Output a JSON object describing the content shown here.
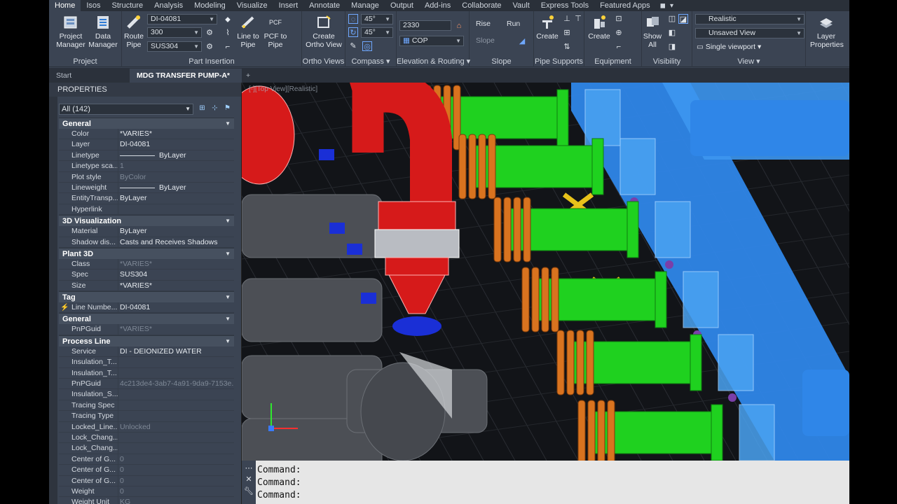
{
  "ribbon_tabs": [
    "Home",
    "Isos",
    "Structure",
    "Analysis",
    "Modeling",
    "Visualize",
    "Insert",
    "Annotate",
    "Manage",
    "Output",
    "Add-ins",
    "Collaborate",
    "Vault",
    "Express Tools",
    "Featured Apps"
  ],
  "project": {
    "project_manager": "Project Manager",
    "data_manager": "Data Manager",
    "title": "Project"
  },
  "part_insertion": {
    "route_pipe": "Route Pipe",
    "line_value": "DI-04081",
    "size_value": "300",
    "spec_value": "SUS304",
    "line_to_pipe": "Line to Pipe",
    "pcf_to_pipe": "PCF to Pipe",
    "pcf_label": "PCF",
    "title": "Part Insertion"
  },
  "ortho": {
    "create": "Create Ortho View",
    "title": "Ortho Views"
  },
  "compass": {
    "angle1": "45°",
    "angle2": "45°",
    "title": "Compass"
  },
  "elevation": {
    "value": "2330",
    "cop": "COP",
    "title": "Elevation & Routing"
  },
  "slope": {
    "rise": "Rise",
    "run": "Run",
    "slope": "Slope",
    "title": "Slope"
  },
  "pipe_supports": {
    "create": "Create",
    "title": "Pipe Supports"
  },
  "equipment": {
    "create": "Create",
    "title": "Equipment"
  },
  "visibility": {
    "show_all": "Show All",
    "title": "Visibility"
  },
  "view": {
    "visual_style": "Realistic",
    "named_view": "Unsaved View",
    "viewport": "Single viewport",
    "title": "View"
  },
  "layer": {
    "props": "Layer Properties"
  },
  "doc_tabs": {
    "start": "Start",
    "active": "MDG TRANSFER PUMP-A*",
    "plus": "+"
  },
  "properties": {
    "header": "PROPERTIES",
    "selection": "All (142)",
    "sections": [
      {
        "title": "General",
        "rows": [
          {
            "k": "Color",
            "v": "*VARIES*"
          },
          {
            "k": "Layer",
            "v": "DI-04081"
          },
          {
            "k": "Linetype",
            "v": "ByLayer",
            "line": true
          },
          {
            "k": "Linetype sca...",
            "v": "1",
            "dim": true
          },
          {
            "k": "Plot style",
            "v": "ByColor",
            "dim": true
          },
          {
            "k": "Lineweight",
            "v": "ByLayer",
            "line": true
          },
          {
            "k": "EntityTransp...",
            "v": "ByLayer"
          },
          {
            "k": "Hyperlink",
            "v": ""
          }
        ]
      },
      {
        "title": "3D Visualization",
        "rows": [
          {
            "k": "Material",
            "v": "ByLayer"
          },
          {
            "k": "Shadow dis...",
            "v": "Casts and Receives Shadows"
          }
        ]
      },
      {
        "title": "Plant 3D",
        "rows": [
          {
            "k": "Class",
            "v": "*VARIES*",
            "dim": true
          },
          {
            "k": "Spec",
            "v": "SUS304"
          },
          {
            "k": "Size",
            "v": "*VARIES*"
          }
        ]
      },
      {
        "title": "Tag",
        "rows": [
          {
            "k": "Line Numbe...",
            "v": "DI-04081",
            "bolt": true
          }
        ]
      },
      {
        "title": "General",
        "rows": [
          {
            "k": "PnPGuid",
            "v": "*VARIES*",
            "dim": true
          }
        ]
      },
      {
        "title": "Process Line",
        "rows": [
          {
            "k": "Service",
            "v": "DI - DEIONIZED WATER"
          },
          {
            "k": "Insulation_T...",
            "v": ""
          },
          {
            "k": "Insulation_T...",
            "v": ""
          },
          {
            "k": "PnPGuid",
            "v": "4c213de4-3ab7-4a91-9da9-7153e...",
            "dim": true
          },
          {
            "k": "Insulation_S...",
            "v": ""
          },
          {
            "k": "Tracing Spec",
            "v": ""
          },
          {
            "k": "Tracing Type",
            "v": ""
          },
          {
            "k": "Locked_Line...",
            "v": "Unlocked",
            "dim": true
          },
          {
            "k": "Lock_Chang...",
            "v": ""
          },
          {
            "k": "Lock_Chang...",
            "v": ""
          },
          {
            "k": "Center of G...",
            "v": "0",
            "dim": true
          },
          {
            "k": "Center of G...",
            "v": "0",
            "dim": true
          },
          {
            "k": "Center of G...",
            "v": "0",
            "dim": true
          },
          {
            "k": "Weight",
            "v": "0",
            "dim": true
          },
          {
            "k": "Weight Unit",
            "v": "KG",
            "dim": true
          }
        ]
      }
    ]
  },
  "viewport_label": "[-][Top View][Realistic]",
  "command": {
    "lines": [
      "Command:",
      "Command:",
      "Command:"
    ]
  },
  "colors": {
    "pipe_red": "#d61a1a",
    "pipe_green": "#1fd11f",
    "flange_orange": "#d9731f",
    "header_blue": "#2f86e8",
    "support_yellow": "#e8c21a",
    "valve_blue": "#1a2fd6",
    "pump_gray": "#4c4f55"
  }
}
